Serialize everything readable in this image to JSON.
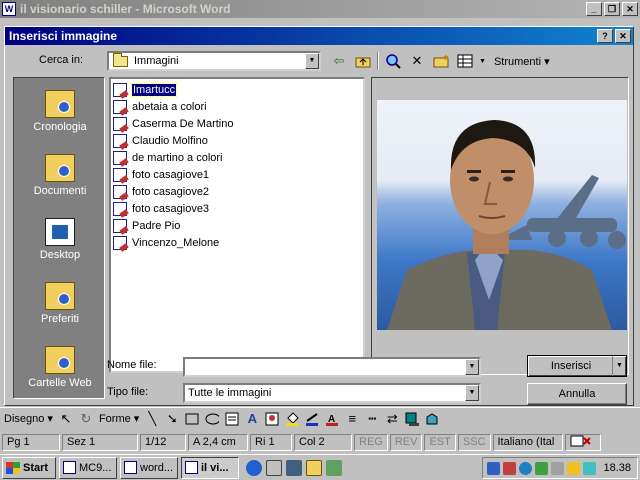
{
  "word_window": {
    "title": "il visionario schiller - Microsoft Word",
    "icon": "word-doc-icon",
    "buttons": [
      "_",
      "❐",
      "✕"
    ]
  },
  "dialog": {
    "title": "Inserisci immagine",
    "title_buttons": [
      "?",
      "✕"
    ],
    "look_in_label": "Cerca in:",
    "look_in_value": "Immagini",
    "toolbar": {
      "icons": [
        "back-arrow-icon",
        "up-folder-icon",
        "search-web-icon",
        "delete-icon",
        "new-folder-icon",
        "views-icon"
      ],
      "tools_label": "Strumenti"
    },
    "places": [
      {
        "label": "Cronologia",
        "icon": "history-folder-icon"
      },
      {
        "label": "Documenti",
        "icon": "documents-folder-icon"
      },
      {
        "label": "Desktop",
        "icon": "desktop-icon"
      },
      {
        "label": "Preferiti",
        "icon": "favorites-folder-icon"
      },
      {
        "label": "Cartelle Web",
        "icon": "web-folders-icon"
      }
    ],
    "files": [
      {
        "name": "Imartucc",
        "selected": true
      },
      {
        "name": "abetaia a colori"
      },
      {
        "name": "Caserma De Martino"
      },
      {
        "name": "Claudio Molfino"
      },
      {
        "name": "de martino a colori"
      },
      {
        "name": "foto casagiove1"
      },
      {
        "name": "foto casagiove2"
      },
      {
        "name": "foto casagiove3"
      },
      {
        "name": "Padre Pio"
      },
      {
        "name": "Vincenzo_Melone"
      }
    ],
    "file_name_label": "Nome file:",
    "file_name_value": "",
    "file_type_label": "Tipo file:",
    "file_type_value": "Tutte le immagini",
    "insert_button": "Inserisci",
    "cancel_button": "Annulla"
  },
  "drawing_toolbar": {
    "draw_label": "Disegno",
    "shapes_label": "Forme"
  },
  "status_bar": {
    "page": "Pg 1",
    "section": "Sez 1",
    "pages": "1/12",
    "position": "A 2,4 cm",
    "line": "Ri 1",
    "column": "Col 2",
    "rec": "REG",
    "rev": "REV",
    "ext": "EST",
    "ovr": "SSC",
    "language": "Italiano (Ital"
  },
  "taskbar": {
    "start_label": "Start",
    "tasks": [
      {
        "label": "MC9...",
        "active": false
      },
      {
        "label": "word...",
        "active": false
      },
      {
        "label": "il vi...",
        "active": true
      }
    ],
    "clock": "18.38"
  }
}
